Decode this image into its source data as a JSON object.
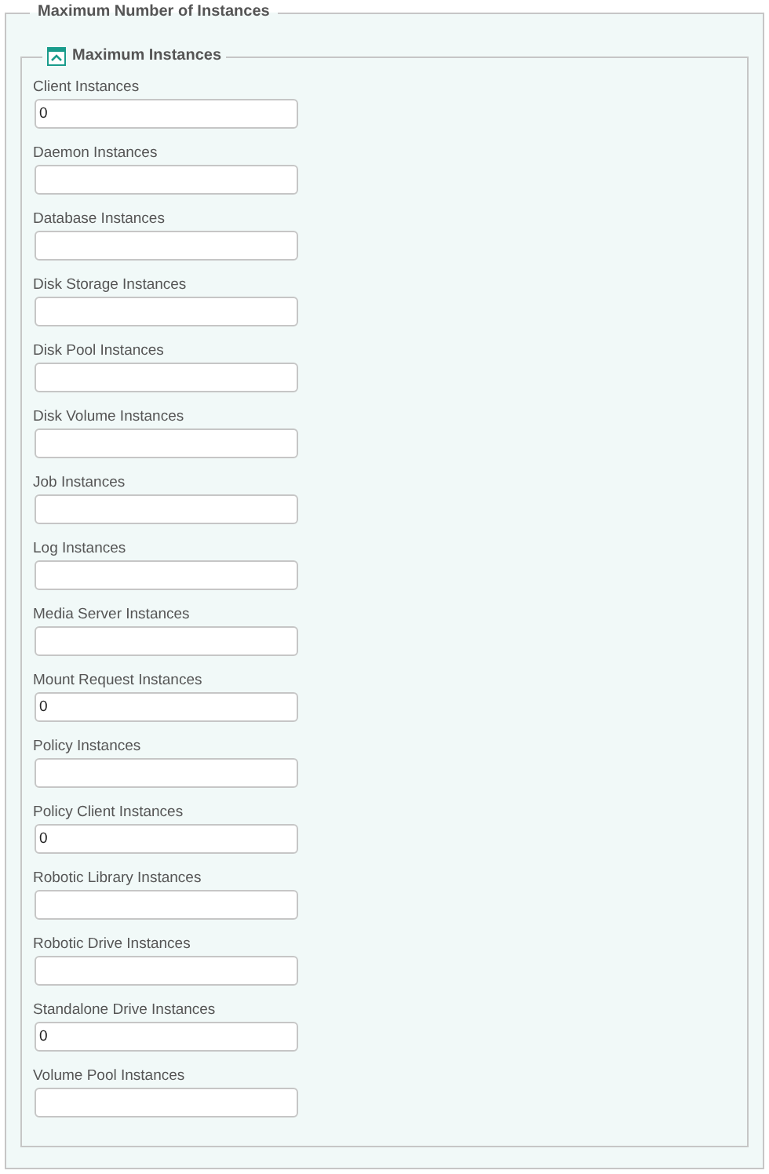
{
  "section": {
    "title": "Maximum Number of Instances"
  },
  "group": {
    "title": "Maximum Instances",
    "expanded": true
  },
  "fields": [
    {
      "label": "Client Instances",
      "value": "0"
    },
    {
      "label": "Daemon Instances"
    },
    {
      "label": "Database Instances"
    },
    {
      "label": "Disk Storage Instances"
    },
    {
      "label": "Disk Pool Instances"
    },
    {
      "label": "Disk Volume Instances"
    },
    {
      "label": "Job Instances"
    },
    {
      "label": "Log Instances"
    },
    {
      "label": "Media Server Instances"
    },
    {
      "label": "Mount Request Instances",
      "value": "0"
    },
    {
      "label": "Policy Instances"
    },
    {
      "label": "Policy Client Instances",
      "value": "0"
    },
    {
      "label": "Robotic Library Instances"
    },
    {
      "label": "Robotic Drive Instances"
    },
    {
      "label": "Standalone Drive Instances",
      "value": "0"
    },
    {
      "label": "Volume Pool Instances"
    }
  ]
}
